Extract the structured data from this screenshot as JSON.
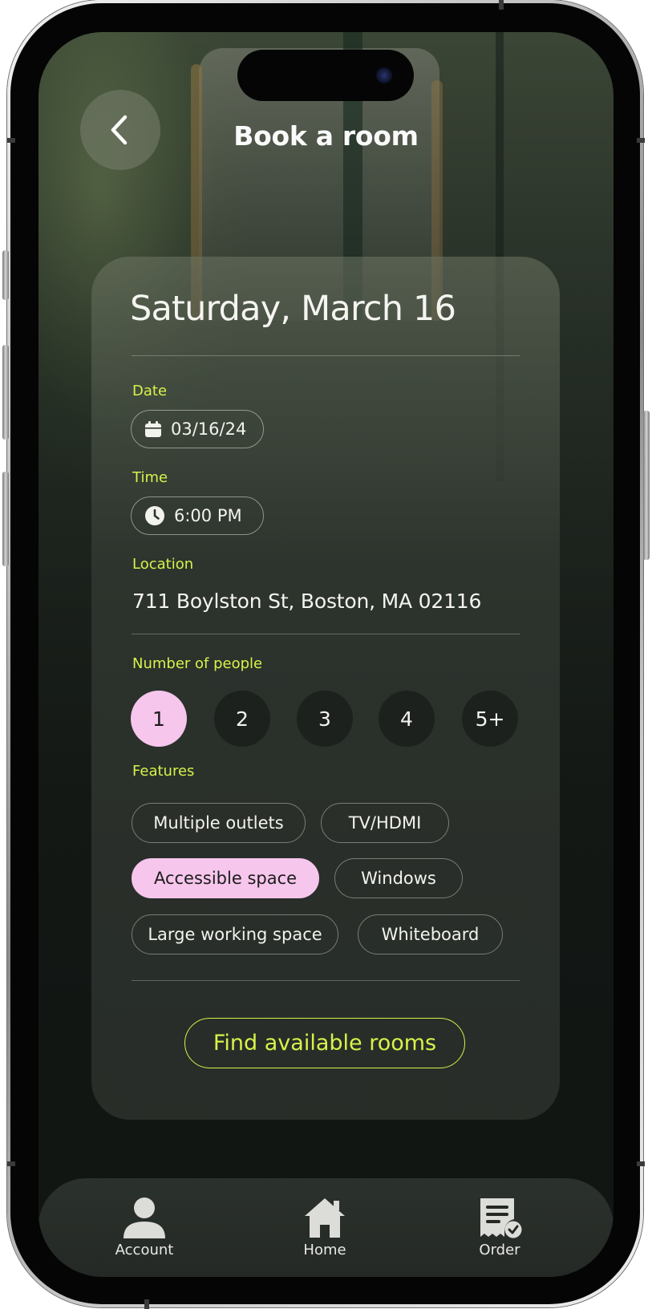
{
  "header": {
    "title": "Book a room",
    "back_icon": "chevron-left-icon"
  },
  "booking": {
    "day_title": "Saturday, March 16",
    "date": {
      "label": "Date",
      "value": "03/16/24",
      "icon": "calendar-icon"
    },
    "time": {
      "label": "Time",
      "value": "6:00 PM",
      "icon": "clock-icon"
    },
    "location": {
      "label": "Location",
      "value": "711 Boylston St, Boston, MA 02116"
    },
    "people": {
      "label": "Number of people",
      "options": [
        "1",
        "2",
        "3",
        "4",
        "5+"
      ],
      "selected": "1"
    },
    "features": {
      "label": "Features",
      "options": [
        {
          "label": "Multiple outlets",
          "selected": false
        },
        {
          "label": "TV/HDMI",
          "selected": false
        },
        {
          "label": "Accessible space",
          "selected": true
        },
        {
          "label": "Windows",
          "selected": false
        },
        {
          "label": "Large working space",
          "selected": false
        },
        {
          "label": "Whiteboard",
          "selected": false
        }
      ]
    },
    "cta_label": "Find available rooms"
  },
  "tabbar": {
    "items": [
      {
        "label": "Account",
        "icon": "person-icon"
      },
      {
        "label": "Home",
        "icon": "house-icon"
      },
      {
        "label": "Order",
        "icon": "receipt-check-icon"
      }
    ]
  },
  "colors": {
    "accent_lime": "#d7f24a",
    "selected_pink": "#f6c6ec",
    "text_light": "#f4f4f0"
  }
}
